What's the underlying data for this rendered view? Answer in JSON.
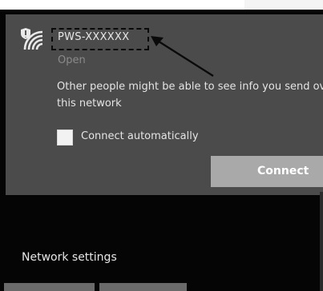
{
  "network": {
    "ssid": "PWS-XXXXXX",
    "security_status": "Open",
    "warning_text": "Other people might be able to see info you send over this network",
    "auto_connect": {
      "label": "Connect automatically",
      "checked": false
    },
    "connect_label": "Connect"
  },
  "footer": {
    "network_settings_label": "Network settings"
  },
  "icons": {
    "wifi": "wifi-shield-icon",
    "annotation": "arrow-icon"
  },
  "colors": {
    "panel": "#4b4b4b",
    "background": "#050505",
    "button": "#a9a9a9",
    "annotation": "#0a0a0a"
  }
}
